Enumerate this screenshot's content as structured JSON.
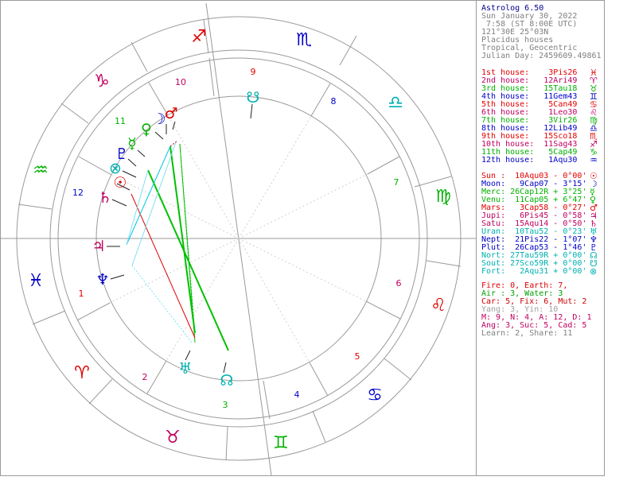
{
  "header": {
    "title": "Astrolog 6.50",
    "date": "Sun January 30, 2022",
    "time": " 7:58 (ST 8:00E UTC)",
    "location": "121°30E 25°03N",
    "house_system": "Placidus houses",
    "zodiac": "Tropical, Geocentric",
    "julian_day": "Julian Day: 2459609.49861"
  },
  "houses": [
    {
      "label": "1st house:",
      "pos": "3Pis26",
      "color": "#e00000",
      "glyph": "♓"
    },
    {
      "label": "2nd house:",
      "pos": "12Ari49",
      "color": "#c00060",
      "glyph": "♈"
    },
    {
      "label": "3rd house:",
      "pos": "15Tau18",
      "color": "#00b000",
      "glyph": "♉"
    },
    {
      "label": "4th house:",
      "pos": "11Gem43",
      "color": "#0000c8",
      "glyph": "♊"
    },
    {
      "label": "5th house:",
      "pos": "5Can49",
      "color": "#e00000",
      "glyph": "♋"
    },
    {
      "label": "6th house:",
      "pos": "1Leo30",
      "color": "#c00060",
      "glyph": "♌"
    },
    {
      "label": "7th house:",
      "pos": "3Vir26",
      "color": "#00b000",
      "glyph": "♍"
    },
    {
      "label": "8th house:",
      "pos": "12Lib49",
      "color": "#0000c8",
      "glyph": "♎"
    },
    {
      "label": "9th house:",
      "pos": "15Sco18",
      "color": "#e00000",
      "glyph": "♏"
    },
    {
      "label": "10th house:",
      "pos": "11Sag43",
      "color": "#c00060",
      "glyph": "♐"
    },
    {
      "label": "11th house:",
      "pos": "5Cap49",
      "color": "#00b000",
      "glyph": "♑"
    },
    {
      "label": "12th house:",
      "pos": "1Aqu30",
      "color": "#0000c8",
      "glyph": "♒"
    }
  ],
  "planets": [
    {
      "name": "Sun :",
      "pos": "10Aqu03",
      "lat": "- 0°00'",
      "color": "#e00000",
      "glyph": "☉"
    },
    {
      "name": "Moon:",
      "pos": "9Cap07",
      "lat": "- 3°15'",
      "color": "#0000c8",
      "glyph": "☽"
    },
    {
      "name": "Merc:",
      "pos": "26Cap12R",
      "lat": "+ 3°25'",
      "color": "#00b000",
      "glyph": "☿"
    },
    {
      "name": "Venu:",
      "pos": "11Cap05",
      "lat": "+ 6°47'",
      "color": "#00b000",
      "glyph": "♀"
    },
    {
      "name": "Mars:",
      "pos": "3Cap58",
      "lat": "- 0°27'",
      "color": "#e00000",
      "glyph": "♂"
    },
    {
      "name": "Jupi:",
      "pos": "6Pis45",
      "lat": "- 0°58'",
      "color": "#c00060",
      "glyph": "♃"
    },
    {
      "name": "Satu:",
      "pos": "15Aqu14",
      "lat": "- 0°50'",
      "color": "#c00060",
      "glyph": "♄"
    },
    {
      "name": "Uran:",
      "pos": "10Tau52",
      "lat": "- 0°23'",
      "color": "#00b0b0",
      "glyph": "♅"
    },
    {
      "name": "Nept:",
      "pos": "21Pis22",
      "lat": "- 1°07'",
      "color": "#0000c8",
      "glyph": "♆"
    },
    {
      "name": "Plut:",
      "pos": "26Cap53",
      "lat": "- 1°46'",
      "color": "#0000c8",
      "glyph": "♇"
    },
    {
      "name": "Nort:",
      "pos": "27Tau59R",
      "lat": "+ 0°00'",
      "color": "#00b0b0",
      "glyph": "☊"
    },
    {
      "name": "Sout:",
      "pos": "27Sco59R",
      "lat": "+ 0°00'",
      "color": "#00b0b0",
      "glyph": "☋"
    },
    {
      "name": "Fort:",
      "pos": "2Aqu31",
      "lat": "+ 0°00'",
      "color": "#00b0b0",
      "glyph": "⊗"
    }
  ],
  "summary": [
    {
      "parts": [
        {
          "t": "Fire: 0, Earth: 7,",
          "c": "#e00000"
        }
      ]
    },
    {
      "parts": [
        {
          "t": "Air : 3, Water: 3",
          "c": "#00a000"
        }
      ]
    },
    {
      "parts": [
        {
          "t": "Car: 5, Fix: 6, Mut: 2",
          "c": "#d00000"
        }
      ]
    },
    {
      "parts": [
        {
          "t": "Yang: 3, Yin: 10",
          "c": "#a0a0a0"
        }
      ]
    },
    {
      "parts": [
        {
          "t": "M: 9, N: 4, A: 12, D: 1",
          "c": "#c00060"
        }
      ]
    },
    {
      "parts": [
        {
          "t": "Ang: 3, Suc: 5, Cad: 5",
          "c": "#c00060"
        }
      ]
    },
    {
      "parts": [
        {
          "t": "Learn: 2, Share: 11",
          "c": "#808080"
        }
      ]
    }
  ],
  "wheel": {
    "signs": [
      {
        "glyph": "♐",
        "color": "#e00000"
      },
      {
        "glyph": "♏",
        "color": "#0000c8"
      },
      {
        "glyph": "♎",
        "color": "#00b0b0"
      },
      {
        "glyph": "♍",
        "color": "#00b000"
      },
      {
        "glyph": "♌",
        "color": "#e00000"
      },
      {
        "glyph": "♋",
        "color": "#0000c8"
      },
      {
        "glyph": "♊",
        "color": "#00b000"
      },
      {
        "glyph": "♉",
        "color": "#c00060"
      },
      {
        "glyph": "♈",
        "color": "#e00000"
      },
      {
        "glyph": "♓",
        "color": "#0000c8"
      },
      {
        "glyph": "♒",
        "color": "#00b000"
      },
      {
        "glyph": "♑",
        "color": "#c00060"
      }
    ],
    "house_numbers": [
      {
        "num": "1",
        "color": "#e00000"
      },
      {
        "num": "2",
        "color": "#c00060"
      },
      {
        "num": "3",
        "color": "#00b000"
      },
      {
        "num": "4",
        "color": "#0000c8"
      },
      {
        "num": "5",
        "color": "#e00000"
      },
      {
        "num": "6",
        "color": "#c00060"
      },
      {
        "num": "7",
        "color": "#00b000"
      },
      {
        "num": "8",
        "color": "#0000c8"
      },
      {
        "num": "9",
        "color": "#e00000"
      },
      {
        "num": "10",
        "color": "#c00060"
      },
      {
        "num": "11",
        "color": "#00b000"
      },
      {
        "num": "12",
        "color": "#0000c8"
      }
    ],
    "planet_glyphs": [
      {
        "glyph": "♂",
        "color": "#e00000"
      },
      {
        "glyph": "☽",
        "color": "#0000c8"
      },
      {
        "glyph": "♀",
        "color": "#00b000"
      },
      {
        "glyph": "☿",
        "color": "#00b000"
      },
      {
        "glyph": "♇",
        "color": "#0000c8"
      },
      {
        "glyph": "⊗",
        "color": "#00b0b0"
      },
      {
        "glyph": "☉",
        "color": "#e00000"
      },
      {
        "glyph": "♄",
        "color": "#c00060"
      },
      {
        "glyph": "♃",
        "color": "#c00060"
      },
      {
        "glyph": "♆",
        "color": "#0000c8"
      },
      {
        "glyph": "♅",
        "color": "#00b0b0"
      },
      {
        "glyph": "☊",
        "color": "#00b0b0"
      },
      {
        "glyph": "☋",
        "color": "#00b0b0"
      }
    ]
  }
}
